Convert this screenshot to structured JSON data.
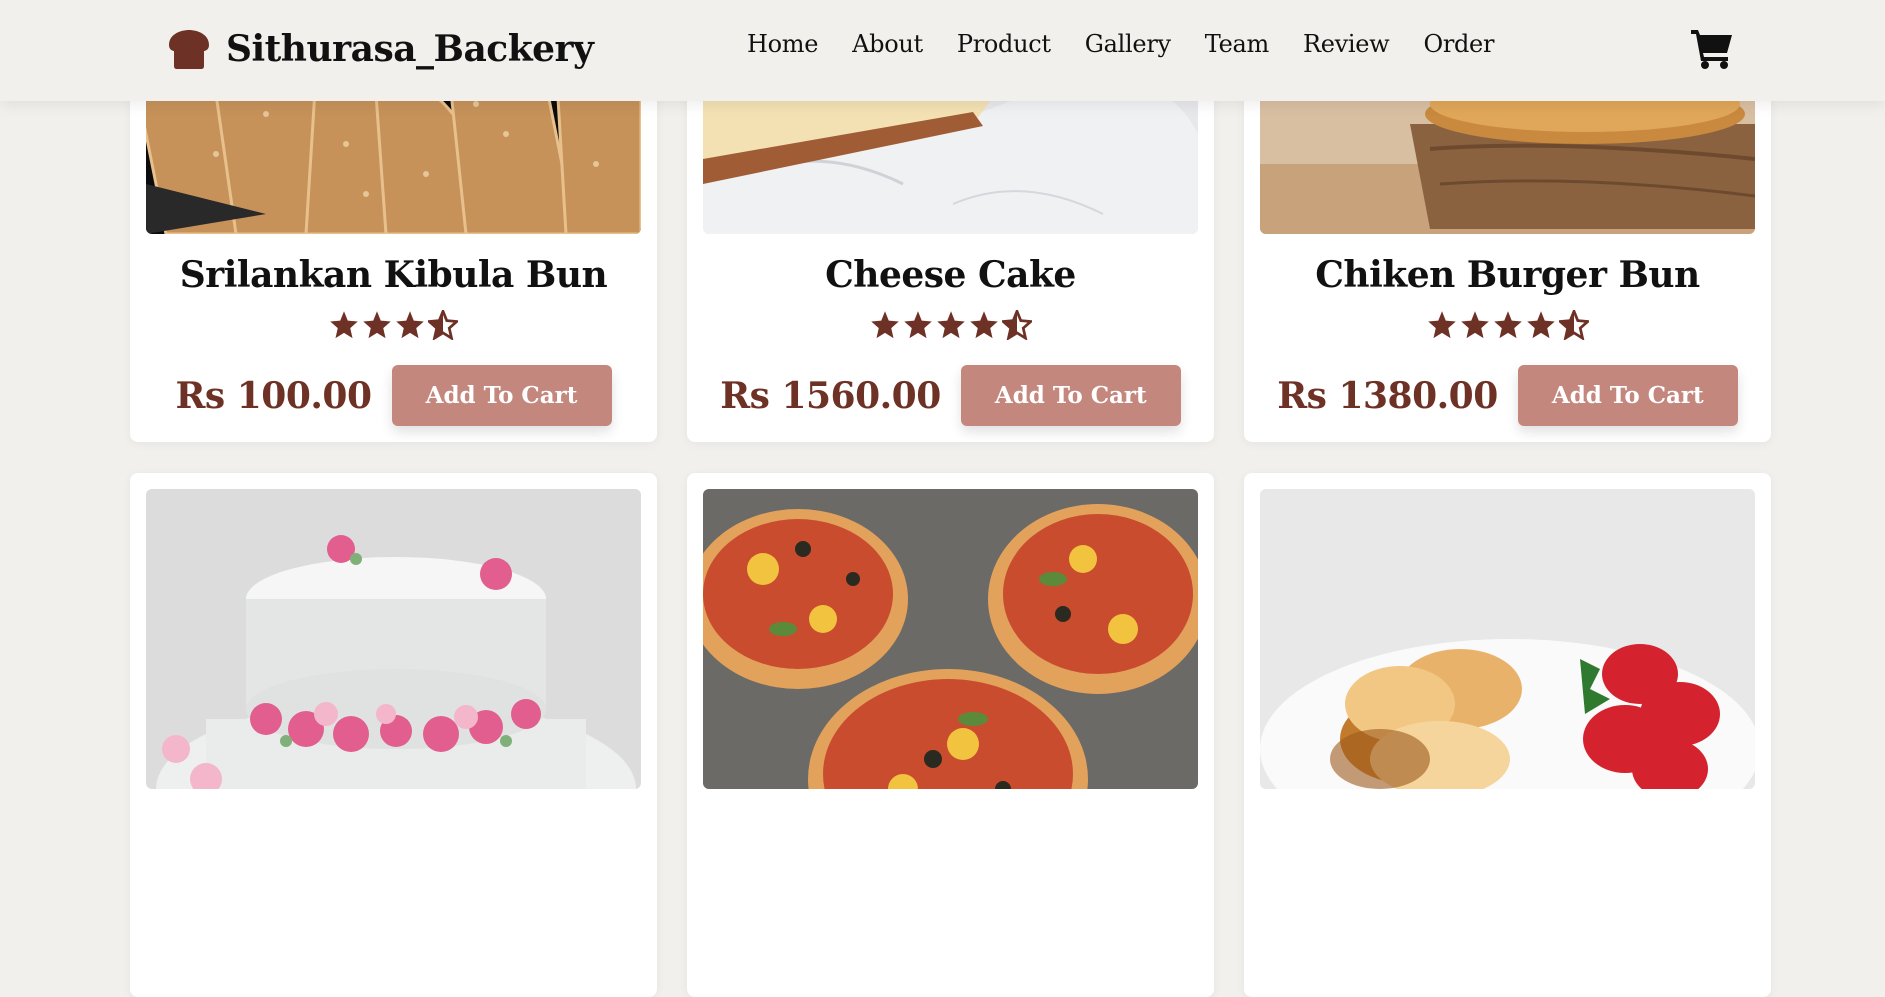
{
  "brand": {
    "name": "Sithurasa_Backery",
    "icon": "bread-icon",
    "color": "#6e3125"
  },
  "nav": {
    "items": [
      "Home",
      "About",
      "Product",
      "Gallery",
      "Team",
      "Review",
      "Order"
    ]
  },
  "cart": {
    "icon": "cart-icon"
  },
  "accent": {
    "price": "#6e3125",
    "button": "#c4877e"
  },
  "products": [
    {
      "name": "Srilankan Kibula Bun",
      "rating": 3.5,
      "price": "Rs 100.00",
      "button": "Add To Cart",
      "image": "kibula-bun-photo"
    },
    {
      "name": "Cheese Cake",
      "rating": 4.5,
      "price": "Rs 1560.00",
      "button": "Add To Cart",
      "image": "cheese-cake-photo"
    },
    {
      "name": "Chiken Burger Bun",
      "rating": 4.5,
      "price": "Rs 1380.00",
      "button": "Add To Cart",
      "image": "burger-bun-photo"
    },
    {
      "image": "birthday-cake-photo"
    },
    {
      "image": "mini-pizza-photo"
    },
    {
      "image": "pancakes-strawberry-photo"
    }
  ]
}
